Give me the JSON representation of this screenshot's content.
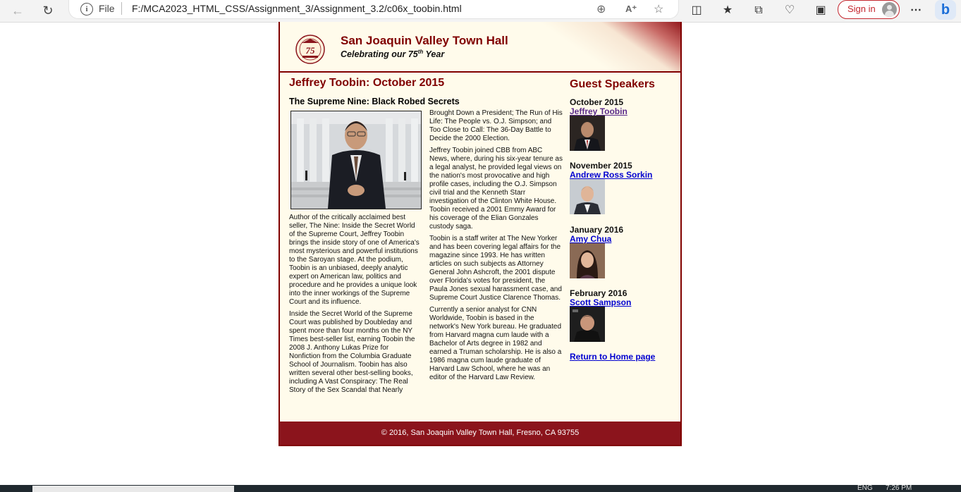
{
  "browser": {
    "scheme": "File",
    "url": "F:/MCA2023_HTML_CSS/Assignment_3/Assignment_3.2/c06x_toobin.html",
    "sign_in": "Sign in"
  },
  "header": {
    "title": "San Joaquin Valley Town Hall",
    "tagline_pre": "Celebrating our ",
    "tagline_num": "75",
    "tagline_sup": "th",
    "tagline_post": " Year",
    "logo_text": "75"
  },
  "main": {
    "heading": "Jeffrey Toobin: October 2015",
    "subheading": "The Supreme Nine: Black Robed Secrets",
    "col1": [
      "Author of the critically acclaimed best seller, The Nine: Inside the Secret World of the Supreme Court, Jeffrey Toobin brings the inside story of one of America's most mysterious and powerful institutions to the Saroyan stage. At the podium, Toobin is an unbiased, deeply analytic expert on American law, politics and procedure and he provides a unique look into the inner workings of the Supreme Court and its influence.",
      "Inside the Secret World of the Supreme Court was published by Doubleday and spent more than four months on the NY Times best-seller list, earning Toobin the 2008 J. Anthony Lukas Prize for Nonfiction from the Columbia Graduate School of Journalism. Toobin has also written several other best-selling books, including A Vast Conspiracy: The Real Story of the Sex Scandal that Nearly"
    ],
    "col2": [
      "Brought Down a President; The Run of His Life: The People vs. O.J. Simpson; and Too Close to Call: The 36-Day Battle to Decide the 2000 Election.",
      "Jeffrey Toobin joined CBB from ABC News, where, during his six-year tenure as a legal analyst, he provided legal views on the nation's most provocative and high profile cases, including the O.J. Simpson civil trial and the Kenneth Starr investigation of the Clinton White House. Toobin received a 2001 Emmy Award for his coverage of the Elian Gonzales custody saga.",
      "Toobin is a staff writer at The New Yorker and has been covering legal affairs for the magazine since 1993. He has written articles on such subjects as Attorney General John Ashcroft, the 2001 dispute over Florida's votes for president, the Paula Jones sexual harassment case, and Supreme Court Justice Clarence Thomas.",
      "Currently a senior analyst for CNN Worldwide, Toobin is based in the network's New York bureau. He graduated from Harvard magna cum laude with a Bachelor of Arts degree in 1982 and earned a Truman scholarship. He is also a 1986 magna cum laude graduate of Harvard Law School, where he was an editor of the Harvard Law Review."
    ]
  },
  "aside": {
    "heading": "Guest Speakers",
    "speakers": [
      {
        "month": "October 2015",
        "name": "Jeffrey Toobin"
      },
      {
        "month": "November 2015",
        "name": "Andrew Ross Sorkin"
      },
      {
        "month": "January 2016",
        "name": "Amy Chua"
      },
      {
        "month": "February 2016",
        "name": "Scott Sampson"
      }
    ],
    "home_link": "Return to Home page"
  },
  "footer": {
    "text": "© 2016, San Joaquin Valley Town Hall, Fresno, CA 93755"
  },
  "taskbar": {
    "lang": "ENG",
    "time": "7:26 PM"
  },
  "colors": {
    "maroon": "#800000",
    "footer_bg": "#8b141c",
    "page_bg": "#fffbeb",
    "link": "#0000d0",
    "visited_link": "#5a2a8a"
  }
}
